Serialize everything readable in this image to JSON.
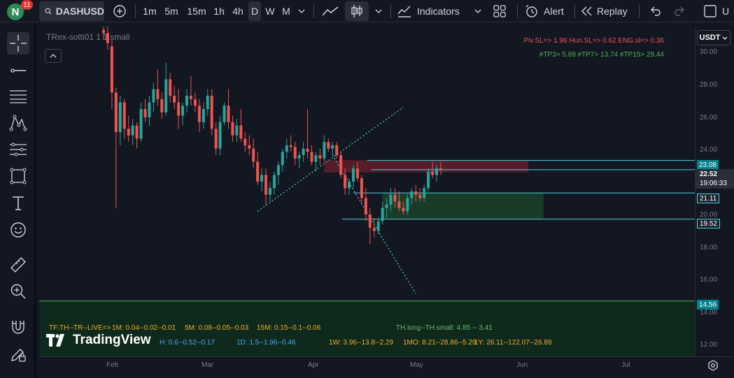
{
  "header": {
    "avatar_letter": "N",
    "notifications": "11",
    "symbol": "DASHUSD",
    "intervals": [
      "1m",
      "5m",
      "15m",
      "1h",
      "4h",
      "D",
      "W",
      "M"
    ],
    "active_interval": "D",
    "indicators_label": "Indicators",
    "alert_label": "Alert",
    "replay_label": "Replay",
    "right_cut": "U"
  },
  "legend": {
    "title": "TRex-sotti01 1 1 small"
  },
  "signals": {
    "sl_line": "Piv.SL=> 1.96  Hun.SL=> 0.62  ENG.sl=> 0.36",
    "tp_line": "#TP3> 5.89  #TP7> 13.74  #TP15> 29.44",
    "row1_a": "TF:TH--TR--LIVE=>",
    "row1_b": "1M: 0.04--0.02--0.01",
    "row1_c": "5M: 0.08--0.05--0.03",
    "row1_d": "15M: 0.15--0.1--0.06",
    "row1_e": "TH.long--TH.small: 4.85 -- 3.41",
    "row2_a": "H: 0.6--0.52--0.17",
    "row2_b": "1D: 1.5--1.96--0.46",
    "row2_c": "1W: 3.96--13.8--2.29",
    "row2_d": "1MO: 8.21--28.86--5.29",
    "row2_e": "1Y: 26.11--122.07--26.89"
  },
  "branding": {
    "logo_text": "TradingView"
  },
  "price_axis": {
    "currency": "USDT",
    "ticks": [
      "30.00",
      "28.00",
      "26.00",
      "24.00",
      "20.00",
      "18.00",
      "16.00",
      "14.00",
      "12.00"
    ],
    "tags": {
      "t1": "23.08",
      "current": "22.52",
      "countdown": "19:06:33",
      "t3": "21.11",
      "t4": "19.52",
      "t5": "14.56"
    }
  },
  "time_axis": {
    "labels": [
      "Feb",
      "Mar",
      "Apr",
      "May",
      "Jun",
      "Jul"
    ]
  },
  "colors": {
    "up": "#26a69a",
    "down": "#ef5350",
    "accent": "#2962ff",
    "line_cyan": "#4dd0e1",
    "zone_red": "#5b1f2a",
    "zone_green": "#1b3d2a",
    "panel_green": "#0f2a1c"
  },
  "chart_data": {
    "type": "candlestick",
    "ylim": [
      11.2,
      31.2
    ],
    "x_axis_months": [
      "Feb",
      "Mar",
      "Apr",
      "May",
      "Jun",
      "Jul"
    ],
    "candles": [
      [
        31.0,
        31.2,
        30.4,
        30.8
      ],
      [
        30.8,
        31.2,
        29.8,
        30.2
      ],
      [
        30.0,
        30.4,
        26.2,
        27.2
      ],
      [
        27.2,
        27.5,
        20.2,
        24.8
      ],
      [
        24.8,
        27.0,
        24.0,
        26.6
      ],
      [
        26.6,
        26.8,
        24.4,
        25.0
      ],
      [
        25.0,
        25.8,
        24.2,
        24.6
      ],
      [
        24.6,
        25.6,
        24.0,
        25.2
      ],
      [
        25.2,
        25.4,
        23.8,
        24.4
      ],
      [
        24.4,
        26.6,
        24.2,
        26.2
      ],
      [
        26.2,
        26.8,
        25.4,
        25.7
      ],
      [
        25.7,
        27.0,
        25.2,
        26.6
      ],
      [
        26.6,
        27.8,
        26.0,
        27.4
      ],
      [
        27.4,
        28.6,
        26.4,
        26.8
      ],
      [
        26.8,
        27.2,
        25.6,
        26.0
      ],
      [
        26.0,
        29.0,
        25.8,
        28.0
      ],
      [
        28.0,
        28.4,
        26.6,
        27.0
      ],
      [
        27.0,
        27.6,
        26.2,
        26.6
      ],
      [
        26.6,
        27.4,
        25.0,
        25.8
      ],
      [
        25.8,
        26.6,
        25.2,
        26.4
      ],
      [
        26.4,
        27.4,
        26.0,
        27.0
      ],
      [
        27.0,
        28.2,
        26.4,
        26.8
      ],
      [
        26.8,
        27.2,
        26.0,
        26.4
      ],
      [
        26.4,
        26.8,
        24.8,
        25.4
      ],
      [
        25.4,
        26.6,
        25.0,
        26.2
      ],
      [
        26.2,
        27.4,
        25.8,
        27.0
      ],
      [
        27.0,
        27.4,
        24.6,
        25.0
      ],
      [
        25.0,
        25.4,
        23.4,
        23.8
      ],
      [
        23.8,
        25.8,
        23.4,
        25.4
      ],
      [
        25.4,
        26.6,
        25.2,
        26.4
      ],
      [
        26.4,
        27.4,
        25.0,
        25.4
      ],
      [
        25.4,
        25.8,
        24.2,
        24.6
      ],
      [
        24.6,
        25.6,
        24.2,
        25.2
      ],
      [
        25.2,
        26.2,
        24.2,
        24.4
      ],
      [
        24.4,
        24.8,
        23.6,
        24.0
      ],
      [
        24.0,
        24.6,
        23.4,
        23.8
      ],
      [
        23.8,
        24.4,
        22.6,
        23.0
      ],
      [
        23.0,
        23.6,
        21.6,
        21.8
      ],
      [
        21.8,
        22.6,
        21.2,
        22.2
      ],
      [
        22.2,
        22.6,
        20.4,
        21.0
      ],
      [
        21.0,
        21.8,
        20.6,
        21.4
      ],
      [
        21.4,
        22.4,
        21.0,
        22.2
      ],
      [
        22.2,
        23.0,
        21.6,
        22.8
      ],
      [
        22.8,
        23.8,
        22.4,
        23.6
      ],
      [
        23.6,
        24.4,
        23.2,
        24.0
      ],
      [
        24.0,
        24.6,
        23.6,
        23.9
      ],
      [
        23.9,
        24.2,
        22.8,
        23.2
      ],
      [
        23.2,
        23.6,
        22.6,
        23.4
      ],
      [
        23.4,
        24.2,
        23.0,
        23.8
      ],
      [
        23.8,
        26.2,
        23.2,
        23.6
      ],
      [
        23.6,
        24.0,
        22.8,
        23.0
      ],
      [
        23.0,
        23.6,
        22.4,
        23.4
      ],
      [
        23.4,
        23.8,
        22.8,
        23.2
      ],
      [
        23.2,
        24.6,
        23.0,
        24.2
      ],
      [
        24.2,
        24.4,
        23.6,
        23.8
      ],
      [
        23.8,
        24.2,
        23.4,
        24.0
      ],
      [
        24.0,
        24.2,
        23.2,
        23.4
      ],
      [
        23.4,
        23.6,
        22.0,
        22.2
      ],
      [
        22.2,
        22.6,
        21.0,
        21.4
      ],
      [
        21.4,
        22.0,
        21.0,
        21.8
      ],
      [
        21.8,
        22.8,
        21.4,
        22.6
      ],
      [
        22.6,
        23.0,
        21.8,
        22.0
      ],
      [
        22.0,
        22.2,
        20.4,
        20.8
      ],
      [
        20.8,
        21.4,
        19.4,
        19.8
      ],
      [
        19.8,
        20.2,
        18.0,
        19.0
      ],
      [
        19.0,
        19.6,
        18.4,
        18.8
      ],
      [
        18.8,
        19.6,
        18.6,
        19.4
      ],
      [
        19.4,
        20.6,
        19.2,
        20.2
      ],
      [
        20.2,
        20.8,
        19.6,
        20.4
      ],
      [
        20.4,
        21.4,
        20.0,
        21.0
      ],
      [
        21.0,
        21.4,
        20.2,
        20.6
      ],
      [
        20.6,
        21.2,
        20.0,
        20.2
      ],
      [
        20.2,
        20.6,
        19.8,
        20.0
      ],
      [
        20.0,
        21.0,
        19.8,
        20.8
      ],
      [
        20.8,
        21.4,
        20.4,
        21.2
      ],
      [
        21.2,
        21.6,
        20.6,
        21.0
      ],
      [
        21.0,
        21.4,
        20.6,
        20.8
      ],
      [
        20.8,
        21.6,
        20.6,
        21.4
      ],
      [
        21.4,
        22.6,
        21.2,
        22.4
      ],
      [
        22.4,
        23.0,
        22.0,
        22.2
      ],
      [
        22.2,
        22.8,
        21.8,
        22.6
      ],
      [
        22.6,
        23.0,
        22.2,
        22.5
      ]
    ],
    "horizontal_levels": [
      23.08,
      22.52,
      21.11,
      19.52,
      14.56
    ],
    "zones": [
      {
        "kind": "supply",
        "top": 23.1,
        "bottom": 22.35
      },
      {
        "kind": "demand",
        "top": 21.1,
        "bottom": 19.55
      }
    ],
    "trend_lines": [
      {
        "from_candle": 37,
        "from_price": 20.0,
        "to_candle": 72,
        "to_price": 26.3
      },
      {
        "from_candle": 55,
        "from_price": 23.4,
        "to_candle": 75,
        "to_price": 15.0
      }
    ]
  }
}
